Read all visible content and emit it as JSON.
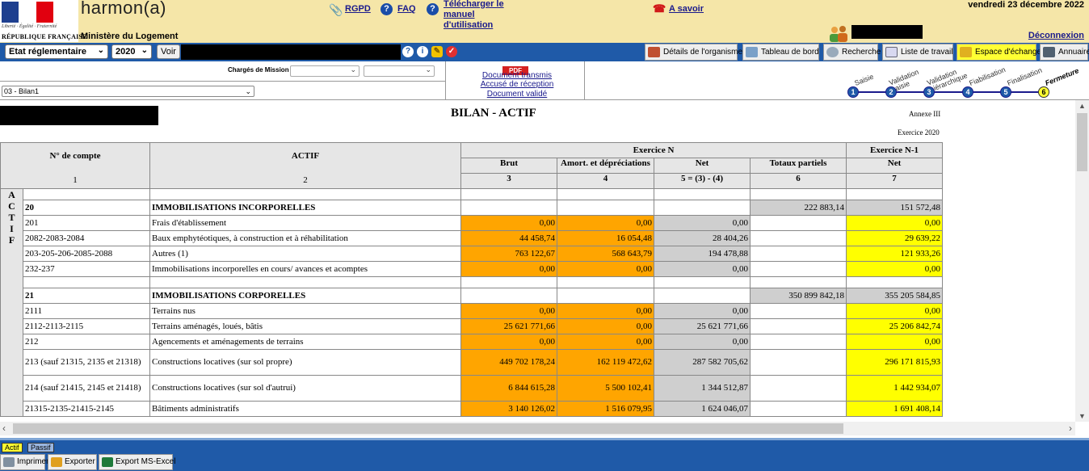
{
  "header": {
    "motto": "Liberté · Égalité · Fraternité",
    "republic": "RÉPUBLIQUE FRANÇAISE",
    "brand": "harmon(a)",
    "ministry": "Ministère du Logement",
    "links": {
      "rgpd": "RGPD",
      "faq": "FAQ",
      "manual": "Télécharger le manuel d'utilisation",
      "a_savoir": "A savoir"
    },
    "date": "vendredi 23 décembre 2022",
    "logout": "Déconnexion"
  },
  "toolbar": {
    "state_select": "Etat réglementaire",
    "year_select": "2020",
    "voir_label": "Voir",
    "buttons": [
      {
        "label": "Détails de l'organisme",
        "icon": "building-icon"
      },
      {
        "label": "Tableau de bord",
        "icon": "dashboard-icon"
      },
      {
        "label": "Recherche",
        "icon": "search-icon"
      },
      {
        "label": "Liste de travail",
        "icon": "list-icon"
      },
      {
        "label": "Espace d'échange",
        "icon": "exchange-icon"
      },
      {
        "label": "Annuaire",
        "icon": "directory-icon"
      }
    ]
  },
  "filters": {
    "charges_label": "Chargés de Mission",
    "bilan_select": "03 - Bilan1",
    "documents": {
      "pdf": "PDF",
      "transmis": "Document transmis",
      "accuse": "Accusé de réception",
      "valide": "Document validé"
    }
  },
  "workflow": {
    "steps": [
      {
        "num": "1",
        "label": "Saisie",
        "current": false
      },
      {
        "num": "2",
        "label": "Validation saisie",
        "current": false
      },
      {
        "num": "3",
        "label": "Validation hiérarchique",
        "current": false
      },
      {
        "num": "4",
        "label": "Fiabilisation",
        "current": false
      },
      {
        "num": "5",
        "label": "Finalisation",
        "current": false
      },
      {
        "num": "6",
        "label": "Fermeture",
        "current": true
      }
    ]
  },
  "report": {
    "title": "BILAN - ACTIF",
    "annex": "Annexe III",
    "exercice": "Exercice 2020",
    "side_label": "ACTIF",
    "headers": {
      "exercice_n": "Exercice N",
      "exercice_n1": "Exercice N-1",
      "compte": "N° de compte",
      "actif": "ACTIF",
      "brut": "Brut",
      "amort": "Amort. et dépréciations",
      "net": "Net",
      "totaux": "Totaux partiels",
      "net_n1": "Net",
      "nums": [
        "1",
        "2",
        "3",
        "4",
        "5 = (3) - (4)",
        "6",
        "7"
      ]
    },
    "sections": [
      {
        "code": "20",
        "label": "IMMOBILISATIONS INCORPORELLES",
        "totaux": "222 883,14",
        "net_n1": "151 572,48",
        "rows": [
          {
            "code": "201",
            "label": "Frais d'établissement",
            "brut": "0,00",
            "amort": "0,00",
            "net": "0,00",
            "net_n1": "0,00"
          },
          {
            "code": "2082-2083-2084",
            "label": "Baux emphytéotiques, à construction et à réhabilitation",
            "brut": "44 458,74",
            "amort": "16 054,48",
            "net": "28 404,26",
            "net_n1": "29 639,22"
          },
          {
            "code": "203-205-206-2085-2088",
            "label": "Autres (1)",
            "brut": "763 122,67",
            "amort": "568 643,79",
            "net": "194 478,88",
            "net_n1": "121 933,26"
          },
          {
            "code": "232-237",
            "label": "Immobilisations incorporelles en cours/ avances et acomptes",
            "brut": "0,00",
            "amort": "0,00",
            "net": "0,00",
            "net_n1": "0,00"
          }
        ]
      },
      {
        "code": "21",
        "label": "IMMOBILISATIONS CORPORELLES",
        "totaux": "350 899 842,18",
        "net_n1": "355 205 584,85",
        "rows": [
          {
            "code": "2111",
            "label": "Terrains nus",
            "brut": "0,00",
            "amort": "0,00",
            "net": "0,00",
            "net_n1": "0,00"
          },
          {
            "code": "2112-2113-2115",
            "label": "Terrains aménagés, loués, bâtis",
            "brut": "25 621 771,66",
            "amort": "0,00",
            "net": "25 621 771,66",
            "net_n1": "25 206 842,74"
          },
          {
            "code": "212",
            "label": "Agencements et aménagements de terrains",
            "brut": "0,00",
            "amort": "0,00",
            "net": "0,00",
            "net_n1": "0,00"
          },
          {
            "code": "213 (sauf 21315, 2135 et 21318)",
            "label": "Constructions locatives (sur sol propre)",
            "brut": "449 702 178,24",
            "amort": "162 119 472,62",
            "net": "287 582 705,62",
            "net_n1": "296 171 815,93"
          },
          {
            "code": "214 (sauf 21415, 2145 et 21418)",
            "label": "Constructions locatives (sur sol d'autrui)",
            "brut": "6 844 615,28",
            "amort": "5 500 102,41",
            "net": "1 344 512,87",
            "net_n1": "1 442 934,07"
          },
          {
            "code": "21315-2135-21415-2145",
            "label": "Bâtiments administratifs",
            "brut": "3 140 126,02",
            "amort": "1 516 079,95",
            "net": "1 624 046,07",
            "net_n1": "1 691 408,14"
          }
        ]
      }
    ]
  },
  "tabs": {
    "actif": "Actif",
    "passif": "Passif"
  },
  "actions": {
    "print": "Imprimer",
    "export": "Exporter",
    "excel": "Export MS-Excel"
  },
  "colors": {
    "header_bg": "#f5e6a8",
    "toolbar_bg": "#1f5aa8",
    "input_cell": "#ffa500",
    "prior_cell": "#ffff00",
    "computed_cell": "#cfcfcf"
  }
}
